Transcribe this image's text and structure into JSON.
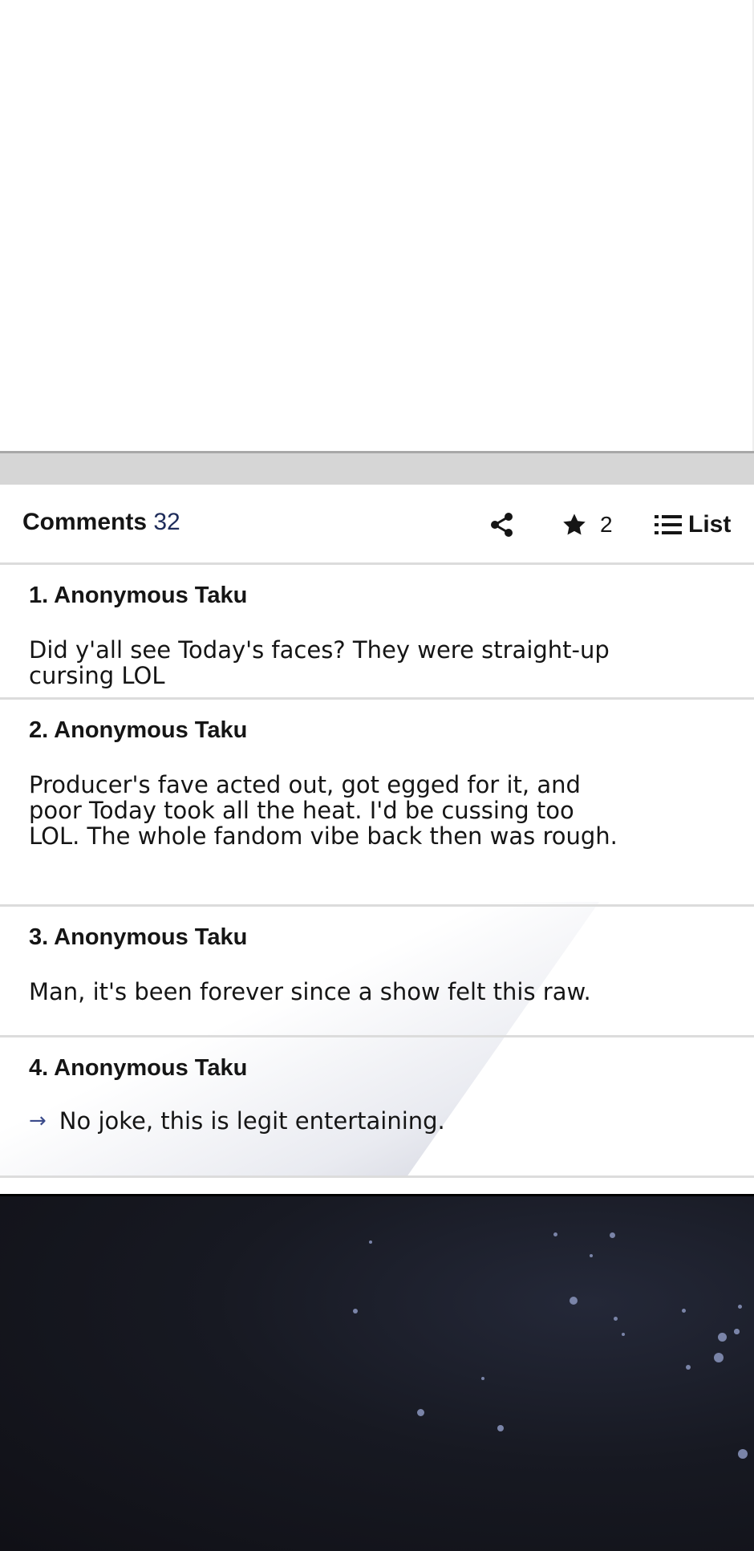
{
  "comments_header": {
    "title": "Comments",
    "count": "32",
    "star_count": "2",
    "list_label": "List"
  },
  "icons": {
    "share": "share-icon",
    "star": "star-icon",
    "list": "list-icon",
    "reply_arrow": "arrow-right-icon"
  },
  "comments": [
    {
      "author": "1. Anonymous Taku",
      "text": "Did y'all see Today's faces? They were straight-up cursing LOL"
    },
    {
      "author": "2. Anonymous Taku",
      "text": "Producer's fave acted out, got egged for it, and poor Today took all the heat. I'd be cussing too LOL. The whole fandom vibe back then was rough."
    },
    {
      "author": "3. Anonymous Taku",
      "text": "Man, it's been forever since a show felt this raw."
    },
    {
      "author": "4. Anonymous Taku",
      "text": "No joke, this is legit entertaining.",
      "arrow": "→"
    }
  ],
  "colors": {
    "count_accent": "#1e2c5a",
    "divider": "#dcdcdc",
    "dark_background": "#101016"
  }
}
